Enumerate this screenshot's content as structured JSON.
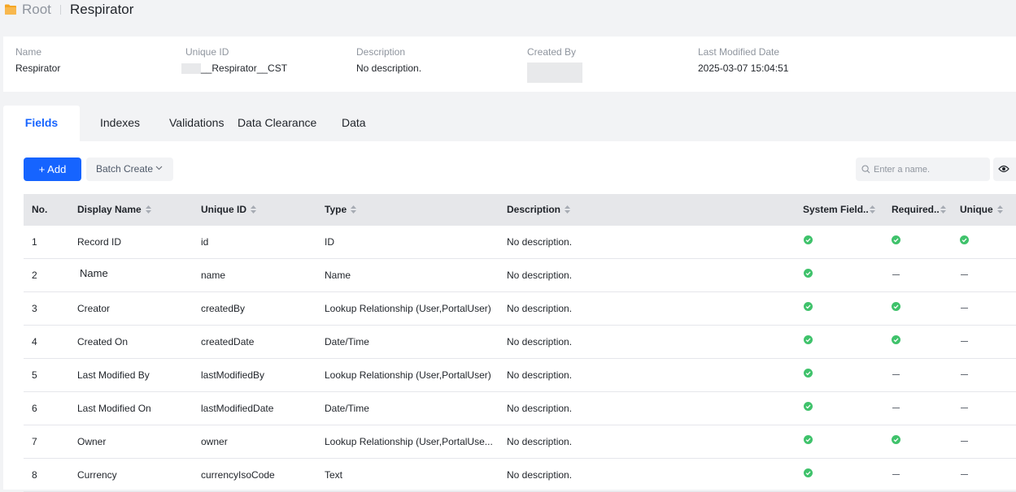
{
  "breadcrumb": {
    "root": "Root",
    "current": "Respirator"
  },
  "info": {
    "name_label": "Name",
    "name_value": "Respirator",
    "uid_label": "Unique ID",
    "uid_value": "__Respirator__CST",
    "desc_label": "Description",
    "desc_value": "No description.",
    "created_by_label": "Created By",
    "modified_label": "Last Modified Date",
    "modified_value": "2025-03-07 15:04:51"
  },
  "tabs": [
    {
      "label": "Fields",
      "active": true
    },
    {
      "label": "Indexes"
    },
    {
      "label": "Validations"
    },
    {
      "label": "Data Clearance"
    },
    {
      "label": "Data"
    }
  ],
  "toolbar": {
    "add_label": "+ Add",
    "batch_label": "Batch Create",
    "search_placeholder": "Enter a name."
  },
  "columns": [
    "No.",
    "Display Name",
    "Unique ID",
    "Type",
    "Description",
    "System Field..",
    "Required..",
    "Unique"
  ],
  "rows": [
    {
      "no": "1",
      "display": "Record ID",
      "uid": "id",
      "type": "ID",
      "desc": "No description.",
      "system": true,
      "required": true,
      "unique": true
    },
    {
      "no": "2",
      "display": "Name",
      "uid": "name",
      "type": "Name",
      "desc": "No description.",
      "system": true,
      "required": false,
      "unique": false
    },
    {
      "no": "3",
      "display": "Creator",
      "uid": "createdBy",
      "type": "Lookup Relationship (User,PortalUser)",
      "desc": "No description.",
      "system": true,
      "required": true,
      "unique": false
    },
    {
      "no": "4",
      "display": "Created On",
      "uid": "createdDate",
      "type": "Date/Time",
      "desc": "No description.",
      "system": true,
      "required": true,
      "unique": false
    },
    {
      "no": "5",
      "display": "Last Modified By",
      "uid": "lastModifiedBy",
      "type": "Lookup Relationship (User,PortalUser)",
      "desc": "No description.",
      "system": true,
      "required": false,
      "unique": false
    },
    {
      "no": "6",
      "display": "Last Modified On",
      "uid": "lastModifiedDate",
      "type": "Date/Time",
      "desc": "No description.",
      "system": true,
      "required": false,
      "unique": false
    },
    {
      "no": "7",
      "display": "Owner",
      "uid": "owner",
      "type": "Lookup Relationship (User,PortalUse...",
      "desc": "No description.",
      "system": true,
      "required": true,
      "unique": false
    },
    {
      "no": "8",
      "display": "Currency",
      "uid": "currencyIsoCode",
      "type": "Text",
      "desc": "No description.",
      "system": true,
      "required": false,
      "unique": false
    }
  ],
  "colors": {
    "primary": "#1664ff",
    "check": "#3fc26b"
  }
}
